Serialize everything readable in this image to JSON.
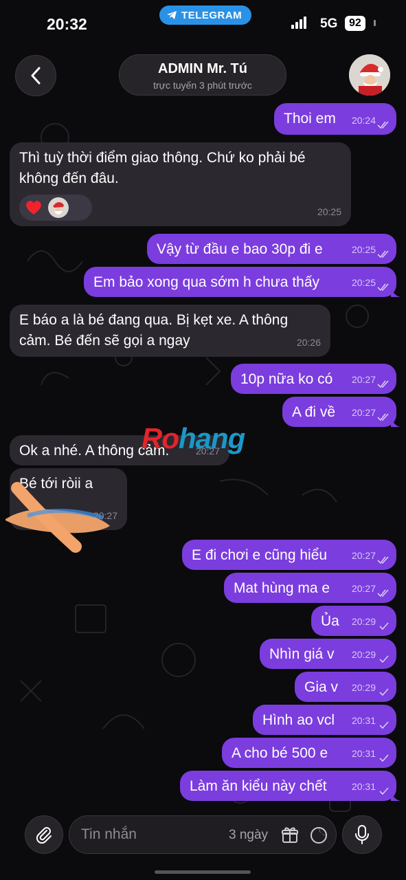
{
  "status_bar": {
    "time": "20:32",
    "app_pill": "TELEGRAM",
    "network": "5G",
    "battery": "92"
  },
  "header": {
    "chat_name": "ADMIN Mr. Tú",
    "chat_status": "trực tuyến 3 phút trước",
    "back_icon": "chevron-left-icon",
    "avatar": "santa-avatar"
  },
  "messages": [
    {
      "dir": "out",
      "text": "Thoi em",
      "time": "20:24",
      "read": true
    },
    {
      "dir": "in",
      "text": "Thì tuỳ thời điểm giao thông. Chứ ko phải bé không đến đâu.",
      "lines": [
        "Thì tuỳ thời điểm giao thông. Chứ ko phải bé",
        "không đến đâu."
      ],
      "time": "20:25",
      "reactions": [
        "heart",
        "santa-avatar"
      ]
    },
    {
      "dir": "out",
      "text": "Vậy từ đầu e bao 30p đi e",
      "time": "20:25",
      "read": true
    },
    {
      "dir": "out",
      "text": "Em bảo xong qua sớm h chưa thấy",
      "time": "20:25",
      "read": true
    },
    {
      "dir": "in",
      "text": "E báo a là bé đang qua. Bị kẹt xe. A thông cảm. Bé đến sẽ gọi a ngay",
      "lines": [
        "E báo a là bé đang qua. Bị kẹt xe. A thông",
        "cảm. Bé đến sẽ gọi a ngay"
      ],
      "time": "20:26"
    },
    {
      "dir": "out",
      "text": "10p nữa ko có",
      "time": "20:27",
      "read": true
    },
    {
      "dir": "out",
      "text": "A đi về",
      "time": "20:27",
      "read": true
    },
    {
      "dir": "in",
      "text": "Ok a nhé. A thông cảm.",
      "time": "20:27"
    },
    {
      "dir": "in",
      "text": "Bé tới ròii a",
      "time": "20:27"
    },
    {
      "dir": "out",
      "text": "E đi chơi e cũng hiểu",
      "time": "20:27",
      "read": true
    },
    {
      "dir": "out",
      "text": "Mat hùng ma e",
      "time": "20:27",
      "read": true
    },
    {
      "dir": "out",
      "text": "Ủa",
      "time": "20:29",
      "read": false
    },
    {
      "dir": "out",
      "text": "Nhìn giá v",
      "time": "20:29",
      "read": false
    },
    {
      "dir": "out",
      "text": "Gia v",
      "time": "20:29",
      "read": false
    },
    {
      "dir": "out",
      "text": "Hình ao vcl",
      "time": "20:31",
      "read": false
    },
    {
      "dir": "out",
      "text": "A cho bé 500 e",
      "time": "20:31",
      "read": false
    },
    {
      "dir": "out",
      "text": "Làm ăn kiểu này chết",
      "time": "20:31",
      "read": false
    }
  ],
  "watermark": {
    "part1": "Ro",
    "part2": "hang"
  },
  "composer": {
    "placeholder": "Tin nhắn",
    "timer_label": "3 ngày",
    "icons": [
      "paperclip-icon",
      "gift-icon",
      "sticker-icon",
      "mic-icon"
    ]
  },
  "colors": {
    "outgoing": "#7b3dde",
    "incoming": "#2b2830",
    "background": "#0b0a0d",
    "accent": "#2a92e6"
  }
}
